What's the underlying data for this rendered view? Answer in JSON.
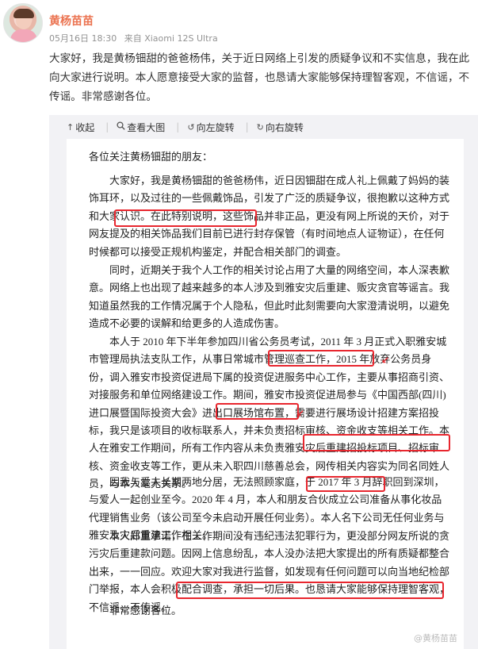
{
  "post": {
    "username": "黄杨苗苗",
    "date": "05月16日 18:30",
    "source": "来自 Xiaomi 12S Ultra",
    "intro": "大家好，我是黄杨钿甜的爸爸杨伟，关于近日网络上引发的质疑争议和不实信息，我在此向大家进行说明。本人愿意接受大家的监督，也恳请大家能够保持理智客观，不信谣，不传谣。非常感谢各位。"
  },
  "toolbar": {
    "collapse": "收起",
    "view_large": "查看大图",
    "rotate_left": "向左旋转",
    "rotate_right": "向右旋转"
  },
  "icons": {
    "collapse": "up-arrow-icon",
    "view_large": "magnifier-icon",
    "rotate_left": "rotate-left-icon",
    "rotate_right": "rotate-right-icon"
  },
  "letter": {
    "salutation": "各位关注黄杨钿甜的朋友：",
    "p1": "大家好，我是黄杨钿甜的爸爸杨伟，近日因钿甜在成人礼上佩戴了妈妈的装饰耳环，以及过往的一些佩戴饰品，引发了广泛的质疑争议，很抱歉以这种方式和大家认识。在此特别说明，这些饰品并非正品，更没有网上所说的天价，对于网友提及的相关饰品我们目前已进行封存保管（有时间地点人证物证），在任何时候都可以接受正规机构鉴定，并配合相关部门的调查。",
    "p2": "同时，近期关于我个人工作的相关讨论占用了大量的网络空间，本人深表歉意。网络上也出现了越来越多的本人涉及到雅安灾后重建、贩灾贪官等谣言。我知道虽然我的工作情况属于个人隐私，但此时此刻需要向大家澄清说明，以避免造成不必要的误解和给更多的人造成伤害。",
    "p3": "本人于 2010 年下半年参加四川省公务员考试，2011 年 3 月正式入职雅安城市管理局执法支队工作，从事日常城市管理巡查工作，2015 年放弃公务员身份，调入雅安市投资促进局下属的投资促进服务中心工作，主要从事招商引资、对接服务和单位网络建设工作。期间，雅安市投资促进局参与《中国西部(四川)进口展暨国际投资大会》进出口展场馆布置，需要进行展场设计招建方案招投标，我只是该项目的收标联系人，并未负责招标审核、资金收支等相关工作。本人在雅安工作期间，所有工作内容从未负责雅安灾后重建招投标项目、招标审核、资金收支等工作，更从未入职四川慈善总会，网传相关内容实为同名同姓人员，与本人毫无关系。",
    "p4": "因我与爱人长期两地分居，无法照顾家庭，于 2017 年 3 月辞职回到深圳，与爱人一起创业至今。2020 年 4 月，本人和朋友合伙成立公司准备从事化妆品代理销售业务（该公司至今未启动开展任何业务）。本人名下公司无任何业务与雅安及灾后重建工作相关。",
    "p5": "本人郑重承诺，在工作期间没有违纪违法犯罪行为，更没部分网友所说的贪污灾后重建款问题。因网上信息纷乱，本人没办法把大家提出的所有质疑都整合出来，一一回应。欢迎大家对我进行监督，如发现有任何问题可以向当地纪检部门举报，本人会积极配合调查，承担一切后果。也恳请大家能够保持理智客观，不信谣，不传谣。",
    "closing": "非常感谢各位。",
    "watermark": "@黄杨苗苗"
  },
  "colors": {
    "username": "#eb7350",
    "highlight_box": "#e8262e",
    "toolbar_bg": "#f2f2f5"
  }
}
